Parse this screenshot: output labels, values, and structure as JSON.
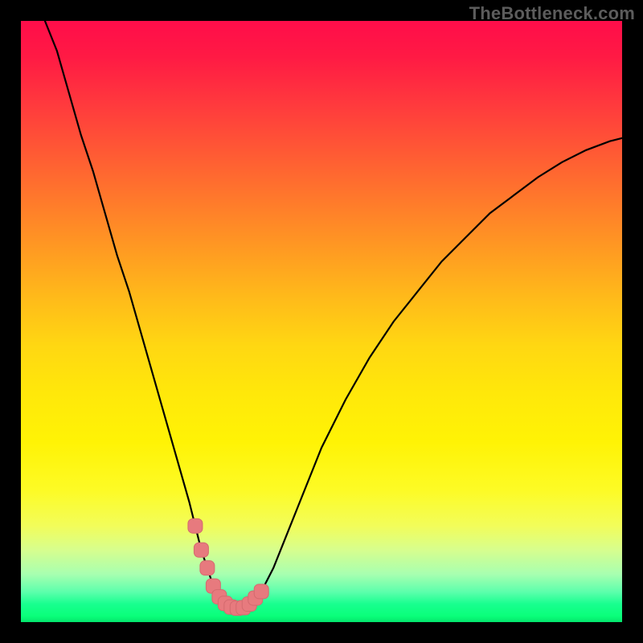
{
  "attribution": "TheBottleneck.com",
  "colors": {
    "curve_stroke": "#000000",
    "marker_fill": "#e77a7e",
    "marker_stroke": "#d46a6e",
    "frame_bg": "#000000"
  },
  "chart_data": {
    "type": "line",
    "title": "",
    "xlabel": "",
    "ylabel": "",
    "xlim": [
      0,
      100
    ],
    "ylim": [
      0,
      100
    ],
    "grid": false,
    "legend": false,
    "series": [
      {
        "name": "bottleneck-curve",
        "x": [
          4,
          6,
          8,
          10,
          12,
          14,
          16,
          18,
          20,
          22,
          24,
          26,
          28,
          29,
          30,
          31,
          32,
          33,
          34,
          35,
          36,
          37,
          38,
          40,
          42,
          44,
          46,
          48,
          50,
          54,
          58,
          62,
          66,
          70,
          74,
          78,
          82,
          86,
          90,
          94,
          98,
          100
        ],
        "values": [
          100,
          95,
          88,
          81,
          75,
          68,
          61,
          55,
          48,
          41,
          34,
          27,
          20,
          16,
          12,
          9,
          6,
          4.2,
          3.1,
          2.5,
          2.3,
          2.4,
          3.0,
          5.1,
          9.0,
          14,
          19,
          24,
          29,
          37,
          44,
          50,
          55,
          60,
          64,
          68,
          71,
          74,
          76.5,
          78.5,
          80,
          80.5
        ]
      }
    ],
    "markers": {
      "name": "highlighted-segment",
      "x": [
        29.0,
        30.0,
        31.0,
        32.0,
        33.0,
        34.0,
        35.0,
        36.0,
        37.0,
        38.0,
        39.0,
        40.0
      ],
      "values": [
        16.0,
        12.0,
        9.0,
        6.0,
        4.2,
        3.1,
        2.5,
        2.3,
        2.4,
        3.0,
        4.0,
        5.1
      ]
    }
  }
}
